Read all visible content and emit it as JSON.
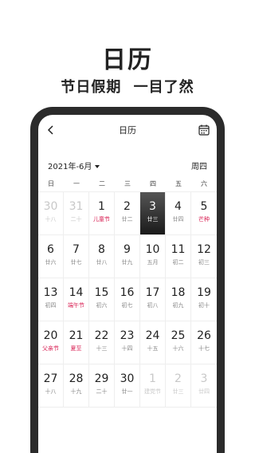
{
  "promo": {
    "title": "日历",
    "subtitle": "节日假期 一目了然"
  },
  "app": {
    "title": "日历",
    "back_icon": "chevron-left-icon",
    "calendar_icon": "calendar-icon",
    "month_selector": "2021年-6月",
    "today_weekday": "周四"
  },
  "weekdays": [
    "日",
    "一",
    "二",
    "三",
    "四",
    "五",
    "六"
  ],
  "colors": {
    "holiday": "#d81e52",
    "today_bg": "#1a1a1a"
  },
  "days": [
    {
      "day": "30",
      "sub": "十八",
      "muted": true
    },
    {
      "day": "31",
      "sub": "二十",
      "muted": true
    },
    {
      "day": "1",
      "sub": "儿童节",
      "holiday": true
    },
    {
      "day": "2",
      "sub": "廿二"
    },
    {
      "day": "3",
      "sub": "廿三",
      "today": true
    },
    {
      "day": "4",
      "sub": "廿四"
    },
    {
      "day": "5",
      "sub": "芒种",
      "holiday": true
    },
    {
      "day": "6",
      "sub": "廿六"
    },
    {
      "day": "7",
      "sub": "廿七"
    },
    {
      "day": "8",
      "sub": "廿八"
    },
    {
      "day": "9",
      "sub": "廿九"
    },
    {
      "day": "10",
      "sub": "五月"
    },
    {
      "day": "11",
      "sub": "初二"
    },
    {
      "day": "12",
      "sub": "初三"
    },
    {
      "day": "13",
      "sub": "初四"
    },
    {
      "day": "14",
      "sub": "端午节",
      "holiday": true
    },
    {
      "day": "15",
      "sub": "初六"
    },
    {
      "day": "16",
      "sub": "初七"
    },
    {
      "day": "17",
      "sub": "初八"
    },
    {
      "day": "18",
      "sub": "初九"
    },
    {
      "day": "19",
      "sub": "初十"
    },
    {
      "day": "20",
      "sub": "父亲节",
      "holiday": true
    },
    {
      "day": "21",
      "sub": "夏至",
      "holiday": true
    },
    {
      "day": "22",
      "sub": "十三"
    },
    {
      "day": "23",
      "sub": "十四"
    },
    {
      "day": "24",
      "sub": "十五"
    },
    {
      "day": "25",
      "sub": "十六"
    },
    {
      "day": "26",
      "sub": "十七"
    },
    {
      "day": "27",
      "sub": "十八"
    },
    {
      "day": "28",
      "sub": "十九"
    },
    {
      "day": "29",
      "sub": "二十"
    },
    {
      "day": "30",
      "sub": "廿一"
    },
    {
      "day": "1",
      "sub": "建党节",
      "muted": true
    },
    {
      "day": "2",
      "sub": "廿三",
      "muted": true
    },
    {
      "day": "3",
      "sub": "廿四",
      "muted": true
    }
  ]
}
